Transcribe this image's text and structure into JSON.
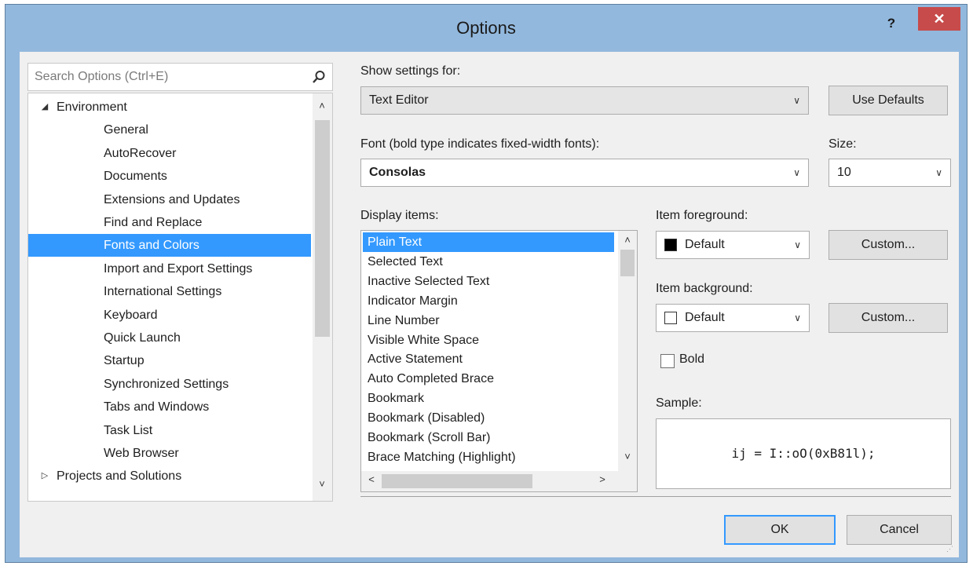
{
  "window": {
    "title": "Options",
    "help_glyph": "?",
    "close_glyph": "✕"
  },
  "search": {
    "placeholder": "Search Options (Ctrl+E)",
    "icon": "search-icon"
  },
  "tree": {
    "items": [
      {
        "label": "Environment",
        "level": 0,
        "expanded": true,
        "toggle": "◢"
      },
      {
        "label": "General",
        "level": 1
      },
      {
        "label": "AutoRecover",
        "level": 1
      },
      {
        "label": "Documents",
        "level": 1
      },
      {
        "label": "Extensions and Updates",
        "level": 1
      },
      {
        "label": "Find and Replace",
        "level": 1
      },
      {
        "label": "Fonts and Colors",
        "level": 1,
        "selected": true
      },
      {
        "label": "Import and Export Settings",
        "level": 1
      },
      {
        "label": "International Settings",
        "level": 1
      },
      {
        "label": "Keyboard",
        "level": 1
      },
      {
        "label": "Quick Launch",
        "level": 1
      },
      {
        "label": "Startup",
        "level": 1
      },
      {
        "label": "Synchronized Settings",
        "level": 1
      },
      {
        "label": "Tabs and Windows",
        "level": 1
      },
      {
        "label": "Task List",
        "level": 1
      },
      {
        "label": "Web Browser",
        "level": 1
      },
      {
        "label": "Projects and Solutions",
        "level": 0,
        "expanded": false,
        "toggle": "▷"
      }
    ]
  },
  "show_settings": {
    "label": "Show settings for:",
    "value": "Text Editor",
    "use_defaults": "Use Defaults"
  },
  "font": {
    "label": "Font (bold type indicates fixed-width fonts):",
    "value": "Consolas"
  },
  "size": {
    "label": "Size:",
    "value": "10"
  },
  "display_items": {
    "label": "Display items:",
    "items": [
      "Plain Text",
      "Selected Text",
      "Inactive Selected Text",
      "Indicator Margin",
      "Line Number",
      "Visible White Space",
      "Active Statement",
      "Auto Completed Brace",
      "Bookmark",
      "Bookmark (Disabled)",
      "Bookmark (Scroll Bar)",
      "Brace Matching (Highlight)"
    ],
    "selected_index": 0
  },
  "item_foreground": {
    "label": "Item foreground:",
    "value": "Default",
    "swatch_color": "#000000",
    "custom": "Custom..."
  },
  "item_background": {
    "label": "Item background:",
    "value": "Default",
    "swatch_color": "#ffffff",
    "custom": "Custom..."
  },
  "bold": {
    "label": "Bold",
    "checked": false
  },
  "sample": {
    "label": "Sample:",
    "text": "ij = I::oO(0xB81l);"
  },
  "footer": {
    "ok": "OK",
    "cancel": "Cancel"
  },
  "colors": {
    "title_bar": "#92b8dd",
    "close_button": "#c74b4b",
    "selection": "#3399ff",
    "client_bg": "#f0f0f0"
  }
}
